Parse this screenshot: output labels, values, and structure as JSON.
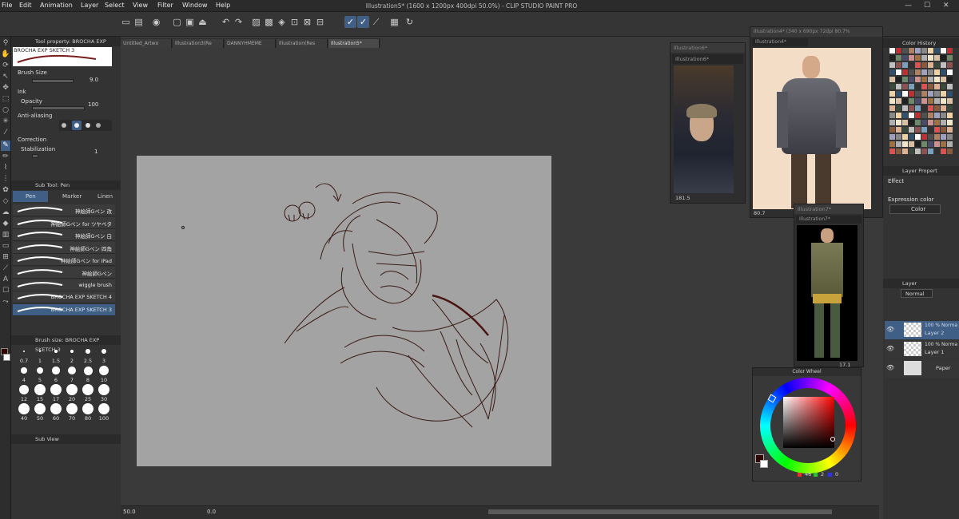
{
  "menu": {
    "items": [
      "File",
      "Edit",
      "Animation",
      "Layer",
      "Select",
      "View",
      "Filter",
      "Window",
      "Help"
    ],
    "title": "Illustration5* (1600 x 1200px 400dpi 50.0%)  - CLIP STUDIO PAINT PRO"
  },
  "tool_property": {
    "header": "Tool property: BROCHA EXP SKETCH",
    "brush_name": "BROCHA EXP SKETCH 3",
    "brush_size_label": "Brush Size",
    "brush_size_value": "9.0",
    "ink_label": "Ink",
    "opacity_label": "Opacity",
    "opacity_value": "100",
    "anti_aliasing_label": "Anti-aliasing",
    "correction_label": "Correction",
    "stabilization_label": "Stabilization",
    "stabilization_value": "1"
  },
  "sub_tool": {
    "header": "Sub Tool: Pen",
    "tabs": [
      "Pen",
      "Marker",
      "Linen"
    ],
    "brushes": [
      "神絵師Gペン 改",
      "神絵師Gペン for ツヤベタ",
      "神絵師Gペン 白",
      "神絵師Gペン 四角",
      "神絵師Gペン for iPad",
      "神絵師Gペン",
      "wiggle brush",
      "BROCHA EXP SKETCH 4",
      "BROCHA EXP SKETCH 3"
    ],
    "selected_index": 8
  },
  "brush_size_panel": {
    "header": "Brush size: BROCHA EXP SKETCH 3",
    "sizes": [
      "0.7",
      "1",
      "1.5",
      "2",
      "2.5",
      "3",
      "4",
      "5",
      "6",
      "7",
      "8",
      "10",
      "12",
      "15",
      "17",
      "20",
      "25",
      "30",
      "40",
      "50",
      "60",
      "70",
      "80",
      "100"
    ],
    "sub_view_label": "Sub View"
  },
  "tabs": [
    "Untitled_Artwo",
    "Illustration3(Re",
    "DANNYHMEME",
    "Illustration(Res",
    "Illustration5*"
  ],
  "windows": {
    "illus6_outer": "Illustration6*",
    "illus6_inner": "Illustration6*",
    "illus6_zoom": "181.5",
    "illus4": "Illustration4* (340 x 690px 72dpi 80.7%",
    "illus4_inner": "Illustration4*",
    "illus4_zoom": "80.7",
    "illus7": "Illustration7*",
    "illus7_inner": "Illustration7*",
    "illus7_zoom": "17.1"
  },
  "color_wheel": {
    "title": "Color Wheel",
    "r": "46",
    "g": "2",
    "b": "0",
    "current_color": "#2e0200"
  },
  "color_history": {
    "header": "Color History"
  },
  "layer_property": {
    "header": "Layer Propert",
    "effect_label": "Effect",
    "expression_label": "Expression color",
    "expression_value": "Color"
  },
  "layer_panel": {
    "header": "Layer",
    "blend_mode": "Normal",
    "layers": [
      {
        "opacity": "100 % Norma",
        "name": "Layer 2",
        "selected": true
      },
      {
        "opacity": "100 % Norma",
        "name": "Layer 1",
        "selected": false
      },
      {
        "opacity": "",
        "name": "Paper",
        "selected": false
      }
    ]
  },
  "status": {
    "zoom": "50.0",
    "rotation": "0.0"
  }
}
